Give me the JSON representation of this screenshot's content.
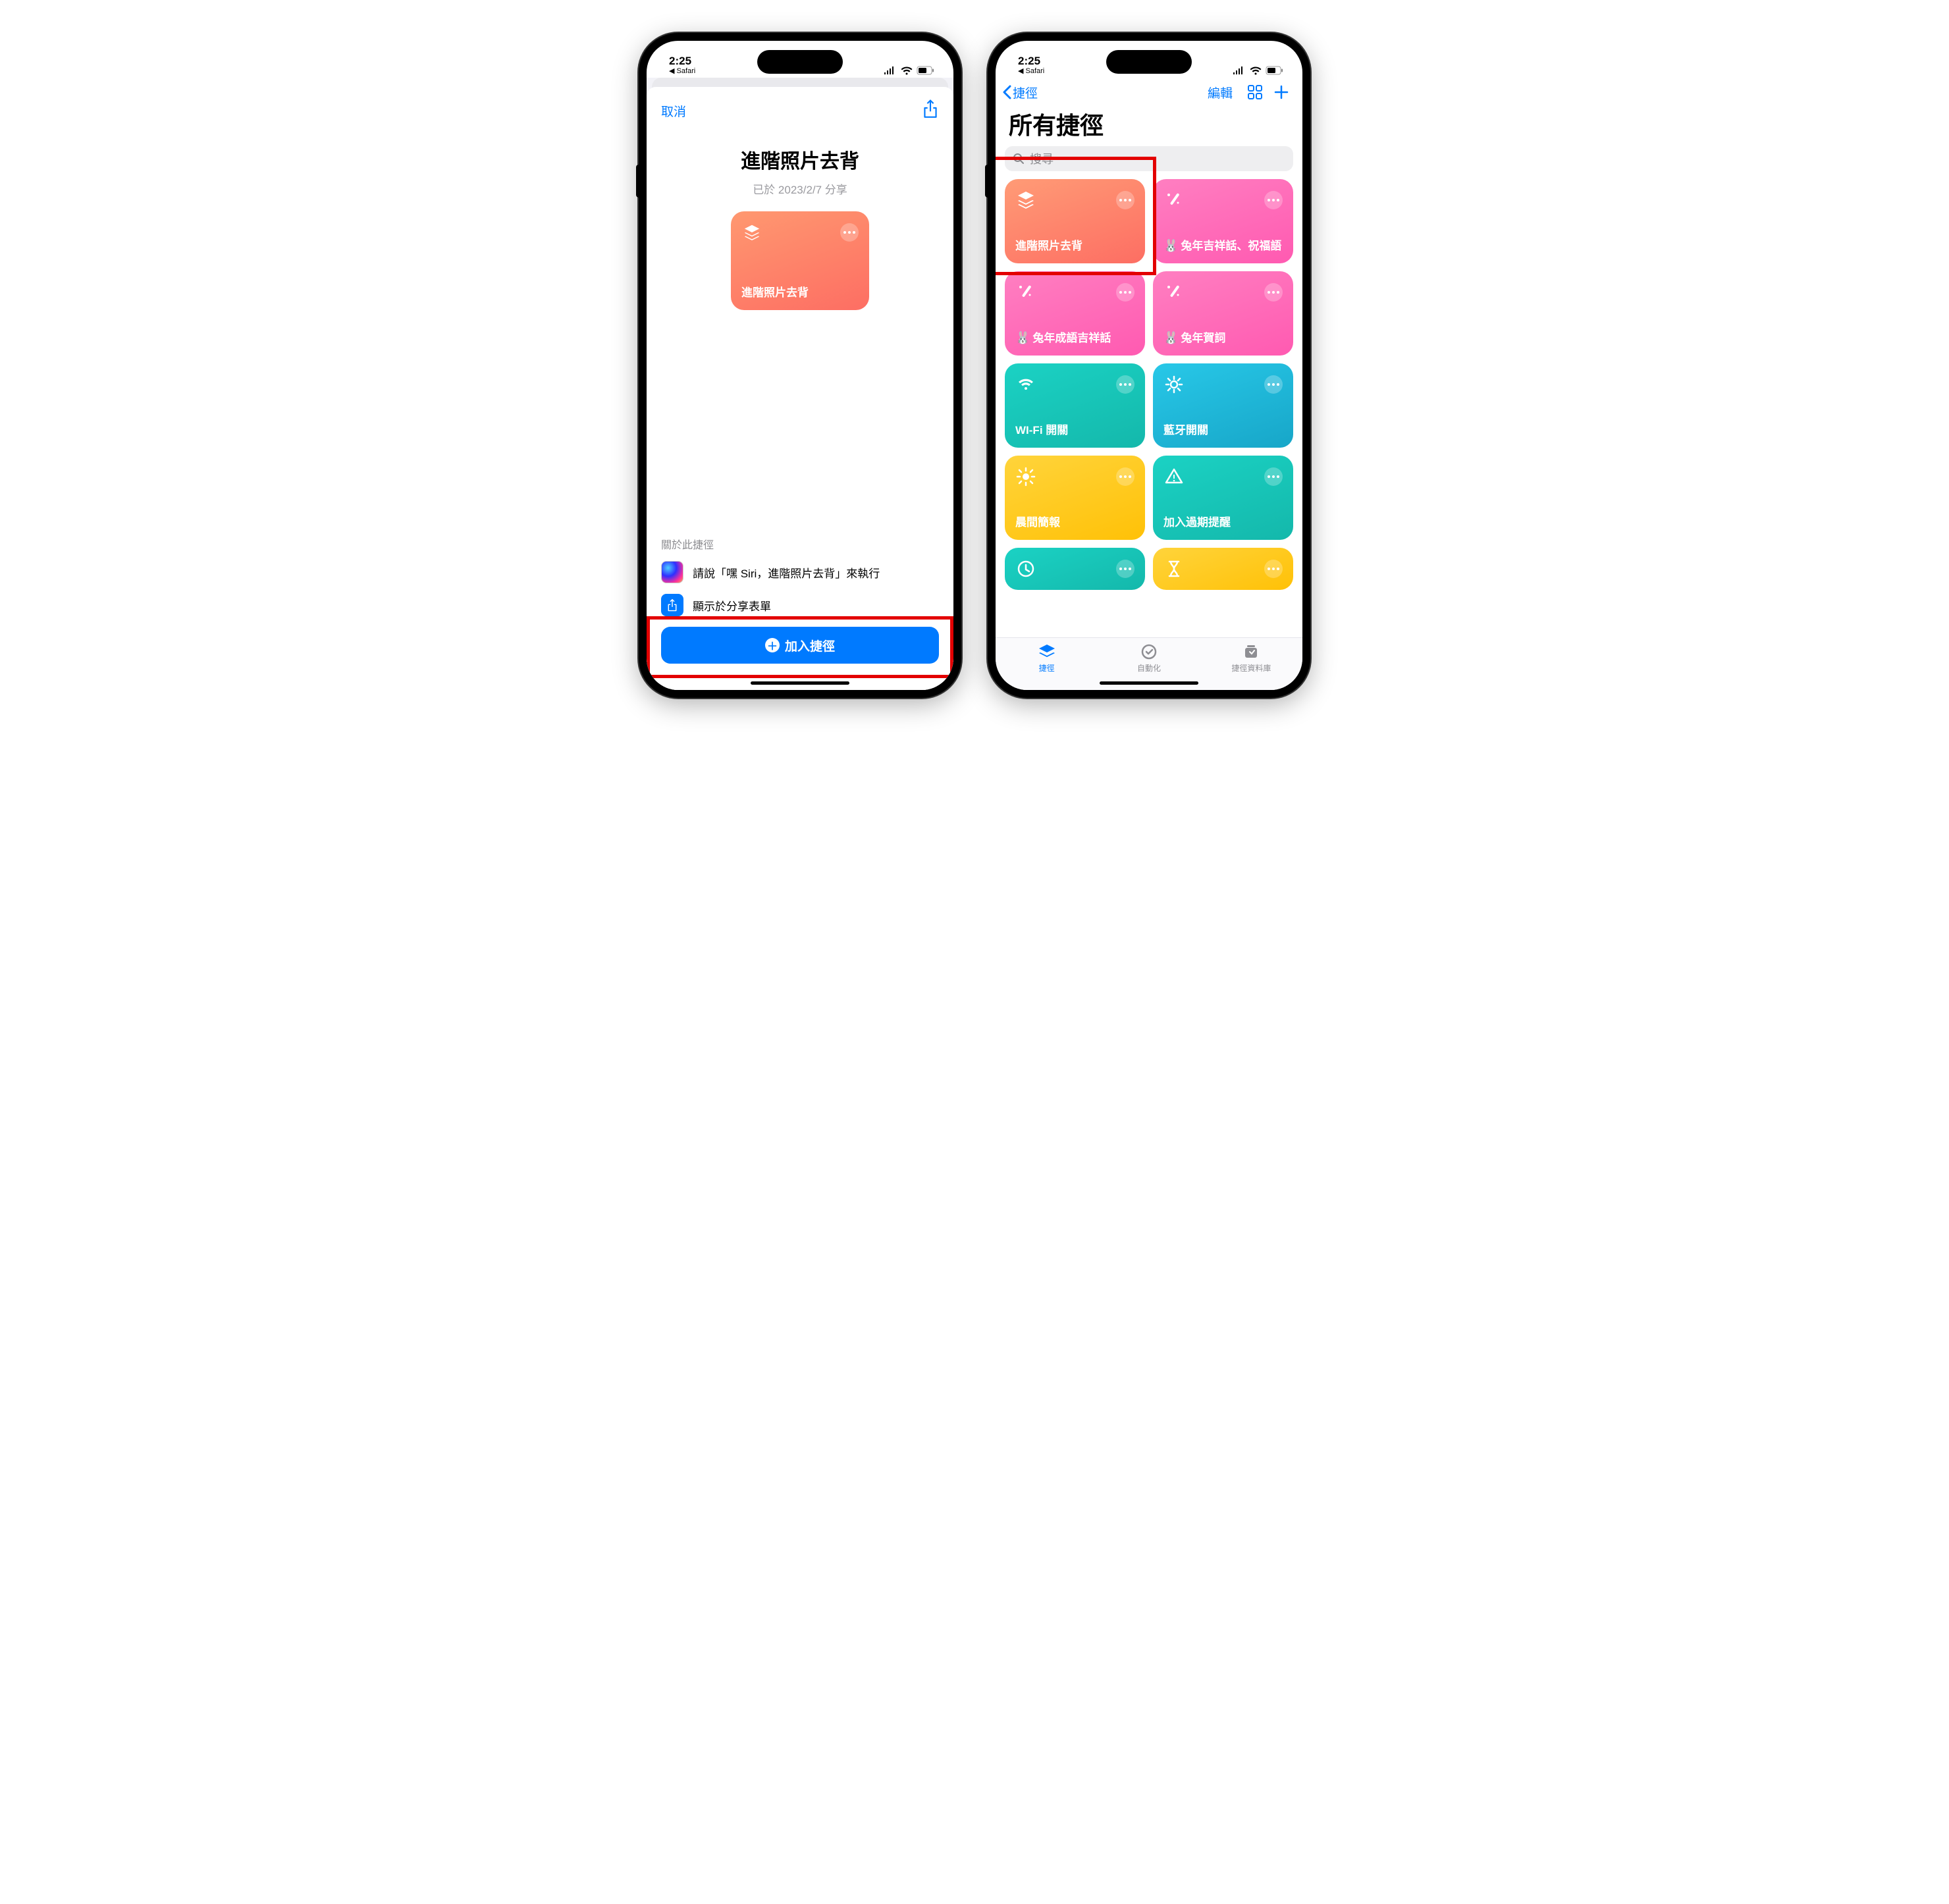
{
  "status": {
    "time": "2:25",
    "back_app": "◀ Safari"
  },
  "left": {
    "cancel": "取消",
    "title": "進階照片去背",
    "shared_on": "已於 2023/2/7 分享",
    "tile_label": "進階照片去背",
    "about_heading": "關於此捷徑",
    "siri_hint": "請說「嘿 Siri，進階照片去背」來執行",
    "share_sheet": "顯示於分享表單",
    "add_button": "加入捷徑"
  },
  "right": {
    "back_label": "捷徑",
    "edit": "編輯",
    "title": "所有捷徑",
    "search_placeholder": "搜尋",
    "tiles": [
      {
        "label": "進階照片去背",
        "emoji": "",
        "color": "g-orange",
        "icon": "stack"
      },
      {
        "label": "兔年吉祥話、祝福語",
        "emoji": "🐰",
        "color": "g-pink",
        "icon": "wand"
      },
      {
        "label": "兔年成語吉祥話",
        "emoji": "🐰",
        "color": "g-pink2",
        "icon": "wand"
      },
      {
        "label": "兔年賀詞",
        "emoji": "🐰",
        "color": "g-pink2",
        "icon": "wand"
      },
      {
        "label": "WI-Fi 開關",
        "emoji": "",
        "color": "g-teal",
        "icon": "wifi"
      },
      {
        "label": "藍牙開關",
        "emoji": "",
        "color": "g-blue",
        "icon": "gear"
      },
      {
        "label": "晨間簡報",
        "emoji": "",
        "color": "g-yellow",
        "icon": "sun"
      },
      {
        "label": "加入過期提醒",
        "emoji": "",
        "color": "g-teal2",
        "icon": "warn"
      }
    ],
    "partial_tiles": [
      {
        "color": "g-teal",
        "icon": "clock"
      },
      {
        "color": "g-yellow",
        "icon": "hourglass"
      }
    ],
    "tabs": {
      "shortcuts": "捷徑",
      "automation": "自動化",
      "gallery": "捷徑資料庫"
    }
  }
}
